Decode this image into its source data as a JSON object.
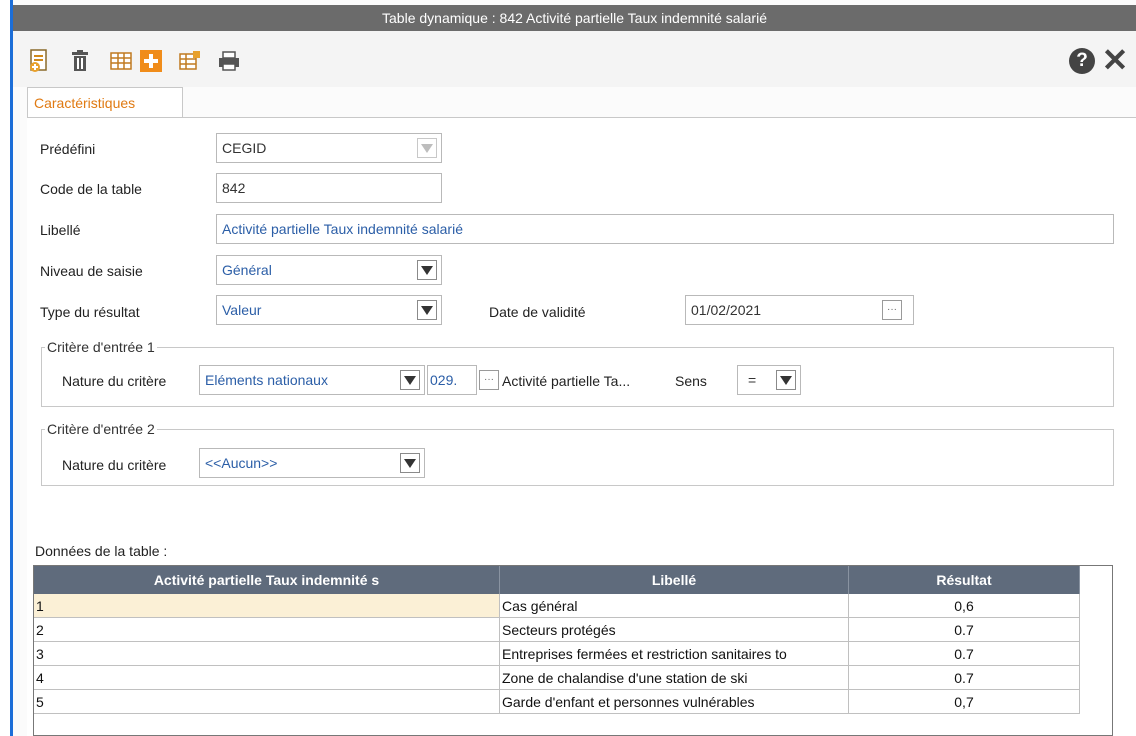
{
  "window": {
    "title": "Table dynamique : 842 Activité partielle Taux indemnité salarié"
  },
  "toolbar": {
    "icons": [
      "new-record-icon",
      "trash-icon",
      "table-grid-icon",
      "add-plus-icon",
      "table-edit-icon",
      "printer-icon"
    ],
    "help_label": "?",
    "close_label": "✕"
  },
  "tabs": [
    {
      "label": "Caractéristiques",
      "active": true
    }
  ],
  "form": {
    "predefini": {
      "label": "Prédéfini",
      "value": "CEGID"
    },
    "code": {
      "label": "Code de la table",
      "value": "842"
    },
    "libelle": {
      "label": "Libellé",
      "value": "Activité partielle Taux indemnité salarié"
    },
    "niveau": {
      "label": "Niveau de saisie",
      "value": "Général"
    },
    "type": {
      "label": "Type du résultat",
      "value": "Valeur"
    },
    "date": {
      "label": "Date de validité",
      "value": "01/02/2021"
    }
  },
  "critere1": {
    "title": "Critère d'entrée 1",
    "nature_label": "Nature du critère",
    "nature_value": "Eléments nationaux",
    "code_value": "029.",
    "desc": "Activité partielle Ta...",
    "sens_label": "Sens",
    "sens_value": "="
  },
  "critere2": {
    "title": "Critère d'entrée 2",
    "nature_label": "Nature du critère",
    "nature_value": "<<Aucun>>"
  },
  "table": {
    "caption": "Données de la table :",
    "columns": [
      "Activité partielle Taux indemnité s",
      "Libellé",
      "Résultat"
    ],
    "rows": [
      [
        "1",
        "Cas général",
        "0,6"
      ],
      [
        "2",
        "Secteurs protégés",
        "0.7"
      ],
      [
        "3",
        "Entreprises fermées et restriction sanitaires to",
        "0.7"
      ],
      [
        "4",
        "Zone de chalandise d'une station de ski",
        "0.7"
      ],
      [
        "5",
        "Garde d'enfant et personnes vulnérables",
        "0,7"
      ]
    ]
  },
  "colors": {
    "accent_tab": "#e07a12",
    "title_bar": "#6b6b6b",
    "grid_header": "#5f6b7c",
    "window_border": "#1c6ed8"
  }
}
